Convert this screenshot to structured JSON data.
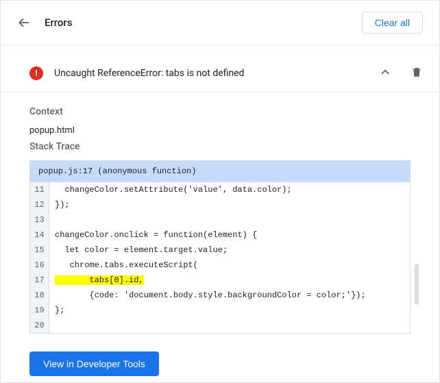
{
  "header": {
    "title": "Errors",
    "clear_all": "Clear all"
  },
  "error": {
    "message": "Uncaught ReferenceError: tabs is not defined"
  },
  "sections": {
    "context_label": "Context",
    "context_value": "popup.html",
    "stack_trace_label": "Stack Trace",
    "stack_header": "popup.js:17 (anonymous function)"
  },
  "code": {
    "lines": [
      {
        "n": "11",
        "t": "  changeColor.setAttribute('value', data.color);",
        "hl": false
      },
      {
        "n": "12",
        "t": "});",
        "hl": false
      },
      {
        "n": "13",
        "t": "",
        "hl": false
      },
      {
        "n": "14",
        "t": "changeColor.onclick = function(element) {",
        "hl": false
      },
      {
        "n": "15",
        "t": "  let color = element.target.value;",
        "hl": false
      },
      {
        "n": "16",
        "t": "   chrome.tabs.executeScript(",
        "hl": false
      },
      {
        "n": "17",
        "t": "       tabs[0].id,",
        "hl": true
      },
      {
        "n": "18",
        "t": "       {code: 'document.body.style.backgroundColor = color;'});",
        "hl": false
      },
      {
        "n": "19",
        "t": "};",
        "hl": false
      },
      {
        "n": "20",
        "t": "",
        "hl": false
      }
    ]
  },
  "footer": {
    "view_devtools": "View in Developer Tools"
  }
}
